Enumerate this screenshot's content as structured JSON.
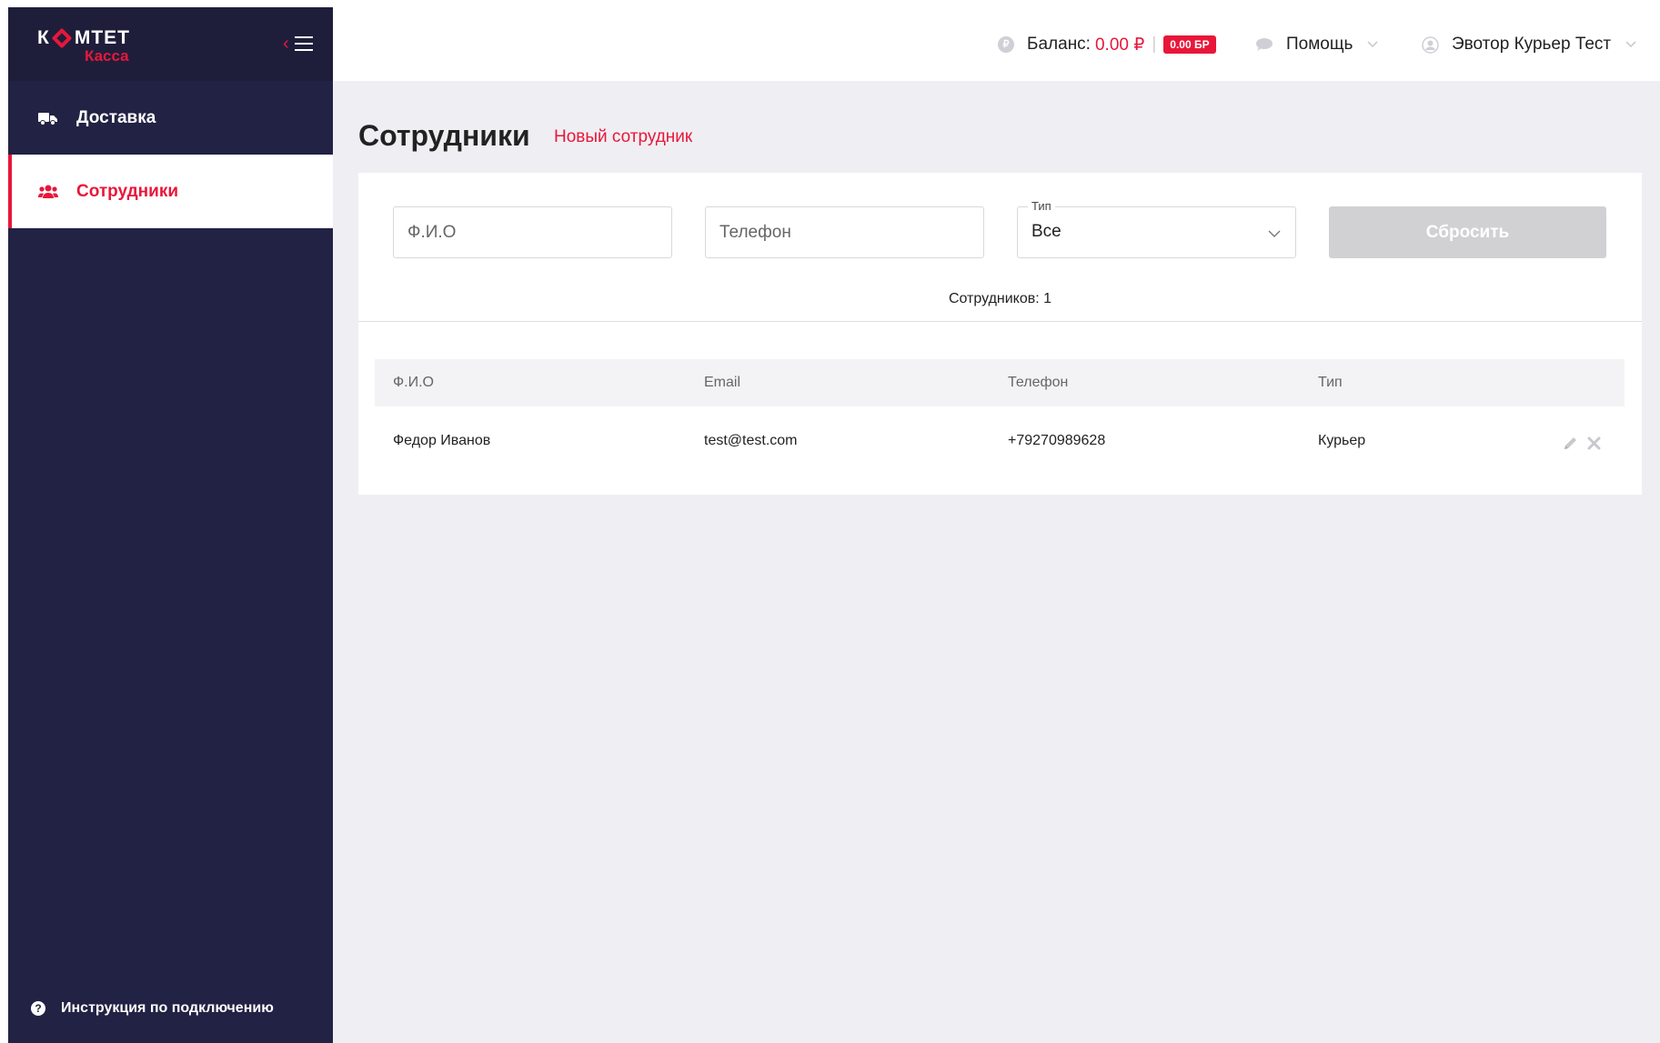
{
  "app": {
    "logo_line1_left": "К",
    "logo_line1_right": "МТЕТ",
    "logo_line2": "Касса"
  },
  "sidebar": {
    "items": [
      {
        "label": "Доставка",
        "icon": "truck-icon",
        "active": false
      },
      {
        "label": "Сотрудники",
        "icon": "users-icon",
        "active": true
      }
    ],
    "help_label": "Инструкция по подключению"
  },
  "header": {
    "balance_label": "Баланс:",
    "balance_amount": "0.00 ₽",
    "separator": "|",
    "bp_badge": "0.00 БР",
    "help_label": "Помощь",
    "user_name": "Эвотор Курьер Тест"
  },
  "main": {
    "title": "Сотрудники",
    "new_staff_link": "Новый сотрудник",
    "filters": {
      "fio_placeholder": "Ф.И.О",
      "phone_placeholder": "Телефон",
      "type_legend": "Тип",
      "type_value": "Все",
      "reset_label": "Сбросить"
    },
    "count_text": "Сотрудников: 1",
    "table": {
      "headers": [
        "Ф.И.О",
        "Email",
        "Телефон",
        "Тип"
      ],
      "rows": [
        {
          "fio": "Федор Иванов",
          "email": "test@test.com",
          "phone": "+79270989628",
          "type": "Курьер"
        }
      ]
    }
  },
  "colors": {
    "accent": "#e8173a",
    "sidebar_bg": "#222244",
    "main_bg": "#efeff3"
  }
}
